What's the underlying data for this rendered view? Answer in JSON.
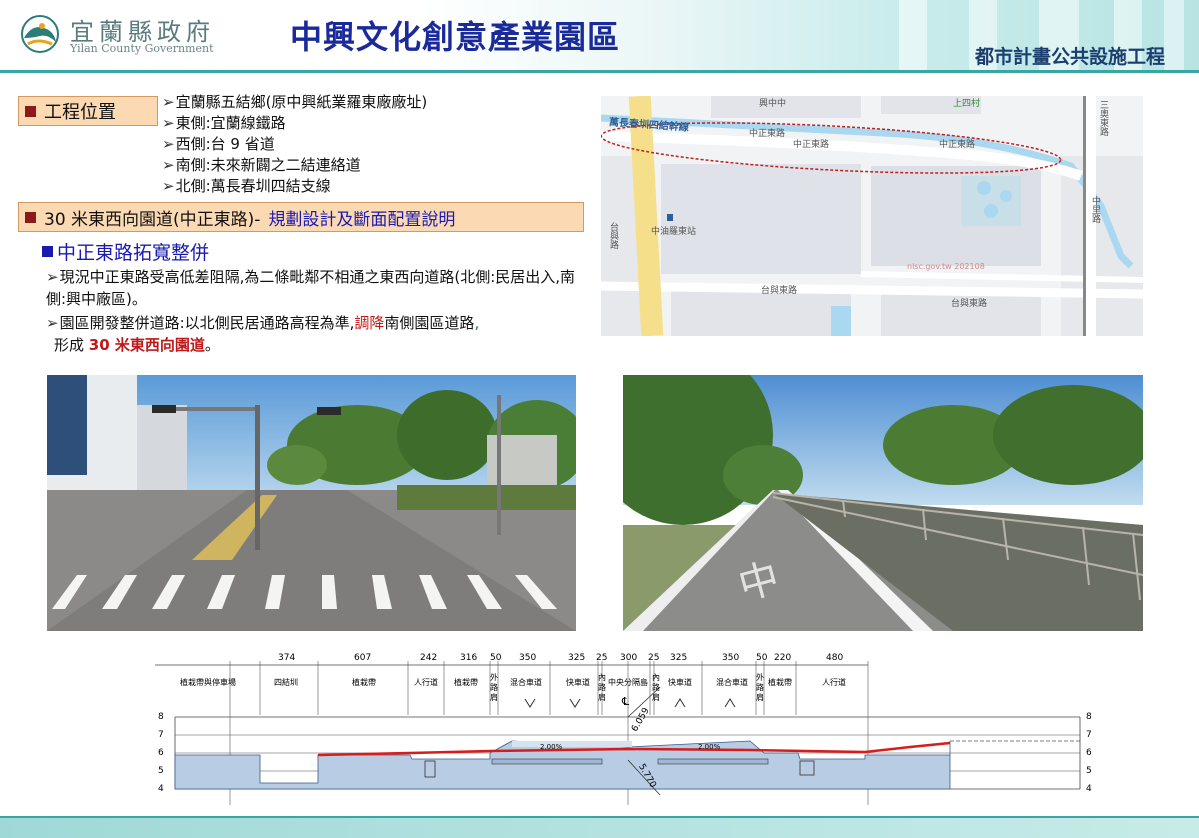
{
  "header": {
    "org_zh": "宜蘭縣政府",
    "org_en": "Yilan County Government",
    "title": "中興文化創意產業園區",
    "subtitle": "都市計畫公共設施工程"
  },
  "location": {
    "label": "工程位置",
    "items": [
      "宜蘭縣五結鄉(原中興紙業羅東廠廠址)",
      "東側:宜蘭線鐵路",
      "西側:台 9 省道",
      "南側:未來新闢之二結連絡道",
      "北側:萬長春圳四結支線"
    ]
  },
  "road_section": {
    "label": "30 米東西向園道(中正東路)-",
    "label_blue": "規劃設計及斷面配置說明",
    "sub_heading": "中正東路拓寬整併",
    "p1": "現況中正東路受高低差阻隔,為二條毗鄰不相通之東西向道路(北側:民居出入,南側:興中廠區)。",
    "p2_a": "園區開發整併道路:以北側民居通路高程為準,",
    "p2_red": "調降",
    "p2_b": "南側園區道路",
    "p2_green": ",",
    "p2_c": "形成 ",
    "p2_redb": "30 米東西向園道",
    "p2_d": "。"
  },
  "map": {
    "labels": [
      "興中中",
      "上四村",
      "萬長春圳四結幹線",
      "中正東路",
      "中正東路",
      "中正東路",
      "台與東路",
      "台與東路",
      "中里路",
      "中油羅東站",
      "台與路",
      "三奧東路",
      "nlsc.gov.tw 202108"
    ],
    "colors": {
      "road_yellow": "#f6df8a",
      "block": "#dfe2e8",
      "water": "#a9d8f0",
      "route": "#c02020"
    }
  },
  "section": {
    "widths": [
      "374",
      "607",
      "242",
      "316",
      "50",
      "350",
      "325",
      "25",
      "300",
      "25",
      "325",
      "350",
      "50",
      "220",
      "480"
    ],
    "labels": [
      "植栽帶與停車場",
      "四結圳",
      "植栽帶",
      "人行道",
      "植栽帶",
      "外路肩",
      "混合車道",
      "快車道",
      "內路肩",
      "中央分隔島",
      "內路肩",
      "快車道",
      "混合車道",
      "外路肩",
      "植栽帶",
      "人行道"
    ],
    "y_ticks": [
      "8",
      "7",
      "6",
      "5",
      "4"
    ],
    "slope_left": "2.00%",
    "slope_right": "2.00%",
    "dim_a": "6.059",
    "dim_b": "5.770",
    "center_mark": "℄"
  }
}
